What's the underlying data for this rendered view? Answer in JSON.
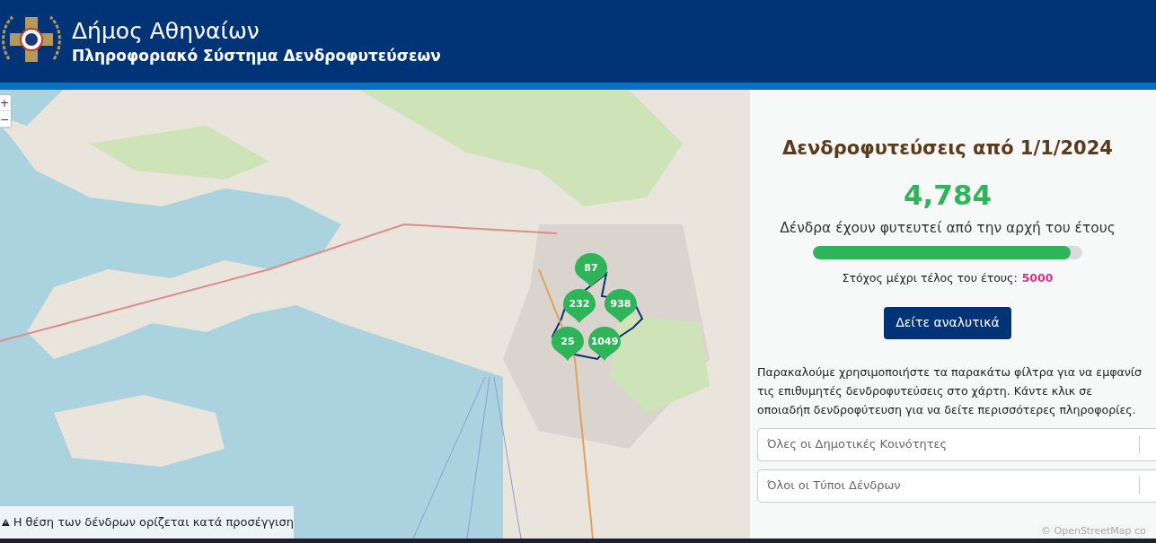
{
  "header": {
    "title": "Δήμος Αθηναίων",
    "subtitle": "Πληροφοριακό Σύστημα Δενδροφυτεύσεων"
  },
  "map": {
    "zoom_controls": [
      "+",
      "−"
    ],
    "markers": [
      {
        "label": "87"
      },
      {
        "label": "232"
      },
      {
        "label": "938"
      },
      {
        "label": "25"
      },
      {
        "label": "1049"
      }
    ],
    "notice": "Η θέση των δένδρων ορίζεται κατά προσέγγιση",
    "attribution": "© OpenStreetMap co"
  },
  "panel": {
    "title": "Δενδροφυτεύσεις από 1/1/2024",
    "count": "4,784",
    "count_caption": "Δένδρα έχουν φυτευτεί από την αρχή του έτους",
    "progress": {
      "level": 0.957
    },
    "target_label": "Στόχος μέχρι τέλος του έτους:",
    "target_value": "5000",
    "details_button": "Δείτε αναλυτικά",
    "instructions": "Παρακαλούμε χρησιμοποιήστε τα παρακάτω φίλτρα για να εμφανίσ τις επιθυμητές δενδροφυτεύσεις στο χάρτη. Κάντε κλικ σε οποιαδήπ δενδροφύτευση για να δείτε περισσότερες πληροφορίες.",
    "filters": [
      {
        "placeholder": "Όλες οι Δημοτικές Κοινότητες"
      },
      {
        "placeholder": "Όλοι οι Τύποι Δένδρων"
      }
    ]
  }
}
